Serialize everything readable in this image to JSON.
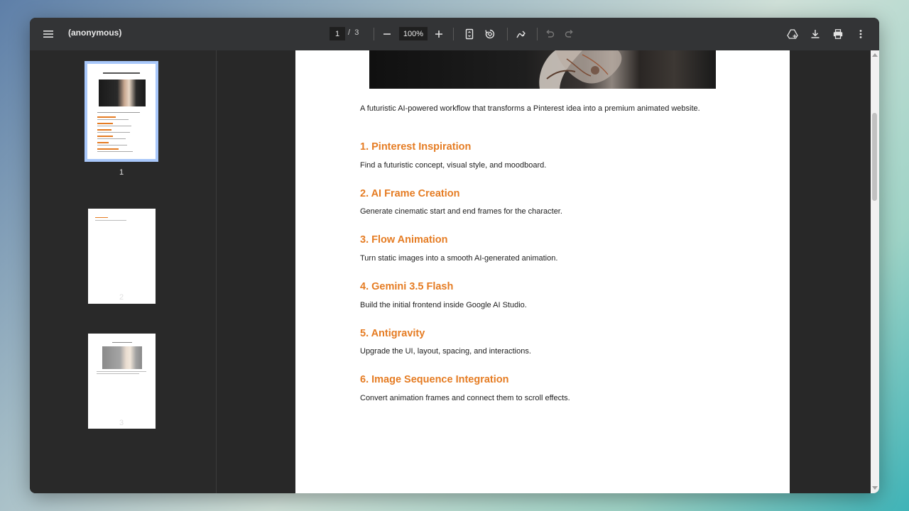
{
  "toolbar": {
    "title": "(anonymous)",
    "current_page": "1",
    "page_separator": "/",
    "total_pages": "3",
    "zoom": "100%"
  },
  "thumbnails": [
    {
      "number": "1",
      "selected": true
    },
    {
      "number": "2",
      "selected": false
    },
    {
      "number": "3",
      "selected": false
    }
  ],
  "document": {
    "intro": "A futuristic AI-powered workflow that transforms a Pinterest idea into a premium animated website.",
    "sections": [
      {
        "heading": "1. Pinterest Inspiration",
        "text": "Find a futuristic concept, visual style, and moodboard."
      },
      {
        "heading": "2. AI Frame Creation",
        "text": "Generate cinematic start and end frames for the character."
      },
      {
        "heading": "3. Flow Animation",
        "text": "Turn static images into a smooth AI-generated animation."
      },
      {
        "heading": "4. Gemini 3.5 Flash",
        "text": "Build the initial frontend inside Google AI Studio."
      },
      {
        "heading": "5. Antigravity",
        "text": "Upgrade the UI, layout, spacing, and interactions."
      },
      {
        "heading": "6. Image Sequence Integration",
        "text": "Convert animation frames and connect them to scroll effects."
      }
    ]
  },
  "colors": {
    "heading_accent": "#e57c23",
    "toolbar_bg": "#333436",
    "thumbnail_selection": "#a8c7fa"
  },
  "icons": {
    "menu": "menu-icon",
    "zoom_out": "minus-icon",
    "zoom_in": "plus-icon",
    "fit": "fit-page-icon",
    "rotate": "rotate-icon",
    "annotate": "draw-icon",
    "undo": "undo-icon",
    "redo": "redo-icon",
    "drive": "drive-save-icon",
    "download": "download-icon",
    "print": "print-icon",
    "more": "more-vert-icon"
  }
}
